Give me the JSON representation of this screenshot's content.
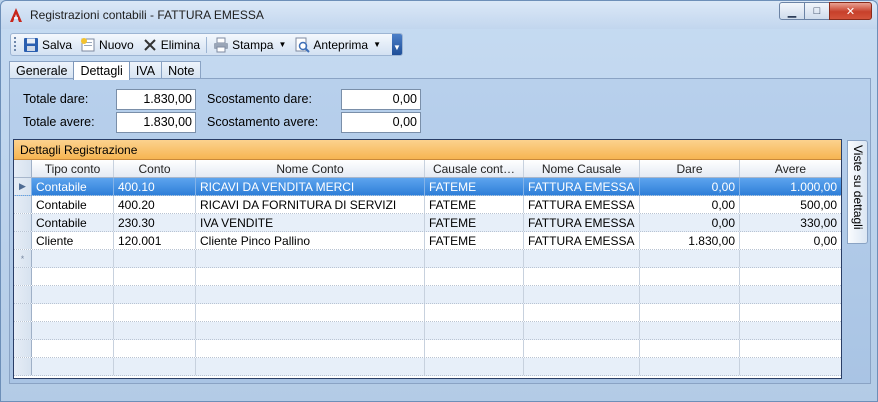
{
  "window": {
    "title": "Registrazioni contabili - FATTURA EMESSA"
  },
  "toolbar": {
    "save_label": "Salva",
    "new_label": "Nuovo",
    "delete_label": "Elimina",
    "print_label": "Stampa",
    "preview_label": "Anteprima"
  },
  "tabs": [
    {
      "label": "Generale"
    },
    {
      "label": "Dettagli"
    },
    {
      "label": "IVA"
    },
    {
      "label": "Note"
    }
  ],
  "totals": {
    "dare_label": "Totale dare:",
    "dare_value": "1.830,00",
    "avere_label": "Totale avere:",
    "avere_value": "1.830,00",
    "scost_dare_label": "Scostamento dare:",
    "scost_dare_value": "0,00",
    "scost_avere_label": "Scostamento avere:",
    "scost_avere_value": "0,00"
  },
  "grid": {
    "title": "Dettagli Registrazione",
    "columns": [
      "Tipo conto",
      "Conto",
      "Nome Conto",
      "Causale cont…",
      "Nome Causale",
      "Dare",
      "Avere"
    ],
    "rows": [
      [
        "Contabile",
        "400.10",
        "RICAVI DA VENDITA MERCI",
        "FATEME",
        "FATTURA EMESSA",
        "0,00",
        "1.000,00"
      ],
      [
        "Contabile",
        "400.20",
        "RICAVI DA FORNITURA DI SERVIZI",
        "FATEME",
        "FATTURA EMESSA",
        "0,00",
        "500,00"
      ],
      [
        "Contabile",
        "230.30",
        "IVA VENDITE",
        "FATEME",
        "FATTURA EMESSA",
        "0,00",
        "330,00"
      ],
      [
        "Cliente",
        "120.001",
        "Cliente Pinco Pallino",
        "FATEME",
        "FATTURA EMESSA",
        "1.830,00",
        "0,00"
      ]
    ],
    "new_row_marker": "*",
    "current_row_marker": "▶"
  },
  "side_tab": {
    "label": "Viste su dettagli"
  },
  "colors": {
    "grid_title": "#f6b552",
    "selected_row": "#3b88de",
    "window_bg": "#b9d1ea"
  }
}
